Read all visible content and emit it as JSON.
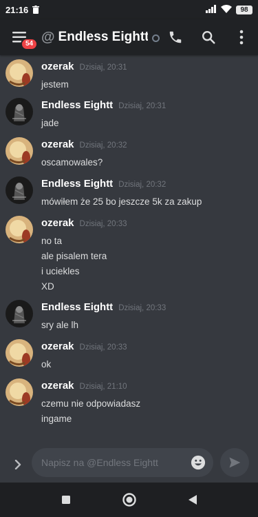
{
  "status_bar": {
    "time": "21:16",
    "battery": "98",
    "trash_icon": "trash-icon",
    "signal_icon": "signal-icon",
    "wifi_icon": "wifi-icon"
  },
  "header": {
    "badge_count": "54",
    "at_symbol": "@",
    "title": "Endless Eightt",
    "status_color": "#747f8d"
  },
  "colors": {
    "background": "#36393f",
    "header": "#202225",
    "badge": "#ed4245",
    "timestamp": "#72767d"
  },
  "messages": [
    {
      "author": "ozerak",
      "timestamp": "Dzisiaj, 20:31",
      "avatar": "ozerak-avatar",
      "lines": [
        "jestem"
      ]
    },
    {
      "author": "Endless Eightt",
      "timestamp": "Dzisiaj, 20:31",
      "avatar": "endless-avatar",
      "lines": [
        "jade"
      ]
    },
    {
      "author": "ozerak",
      "timestamp": "Dzisiaj, 20:32",
      "avatar": "ozerak-avatar",
      "lines": [
        "oscamowales?"
      ]
    },
    {
      "author": "Endless Eightt",
      "timestamp": "Dzisiaj, 20:32",
      "avatar": "endless-avatar",
      "lines": [
        "mówiłem że 25 bo jeszcze 5k za zakup"
      ]
    },
    {
      "author": "ozerak",
      "timestamp": "Dzisiaj, 20:33",
      "avatar": "ozerak-avatar",
      "lines": [
        "no ta",
        "ale pisalem tera",
        "i uciekles",
        "XD"
      ]
    },
    {
      "author": "Endless Eightt",
      "timestamp": "Dzisiaj, 20:33",
      "avatar": "endless-avatar",
      "lines": [
        "sry ale lh"
      ]
    },
    {
      "author": "ozerak",
      "timestamp": "Dzisiaj, 20:33",
      "avatar": "ozerak-avatar",
      "lines": [
        "ok"
      ]
    },
    {
      "author": "ozerak",
      "timestamp": "Dzisiaj, 21:10",
      "avatar": "ozerak-avatar",
      "lines": [
        "czemu nie odpowiadasz",
        "ingame"
      ]
    }
  ],
  "composer": {
    "placeholder": "Napisz na @Endless Eightt"
  }
}
